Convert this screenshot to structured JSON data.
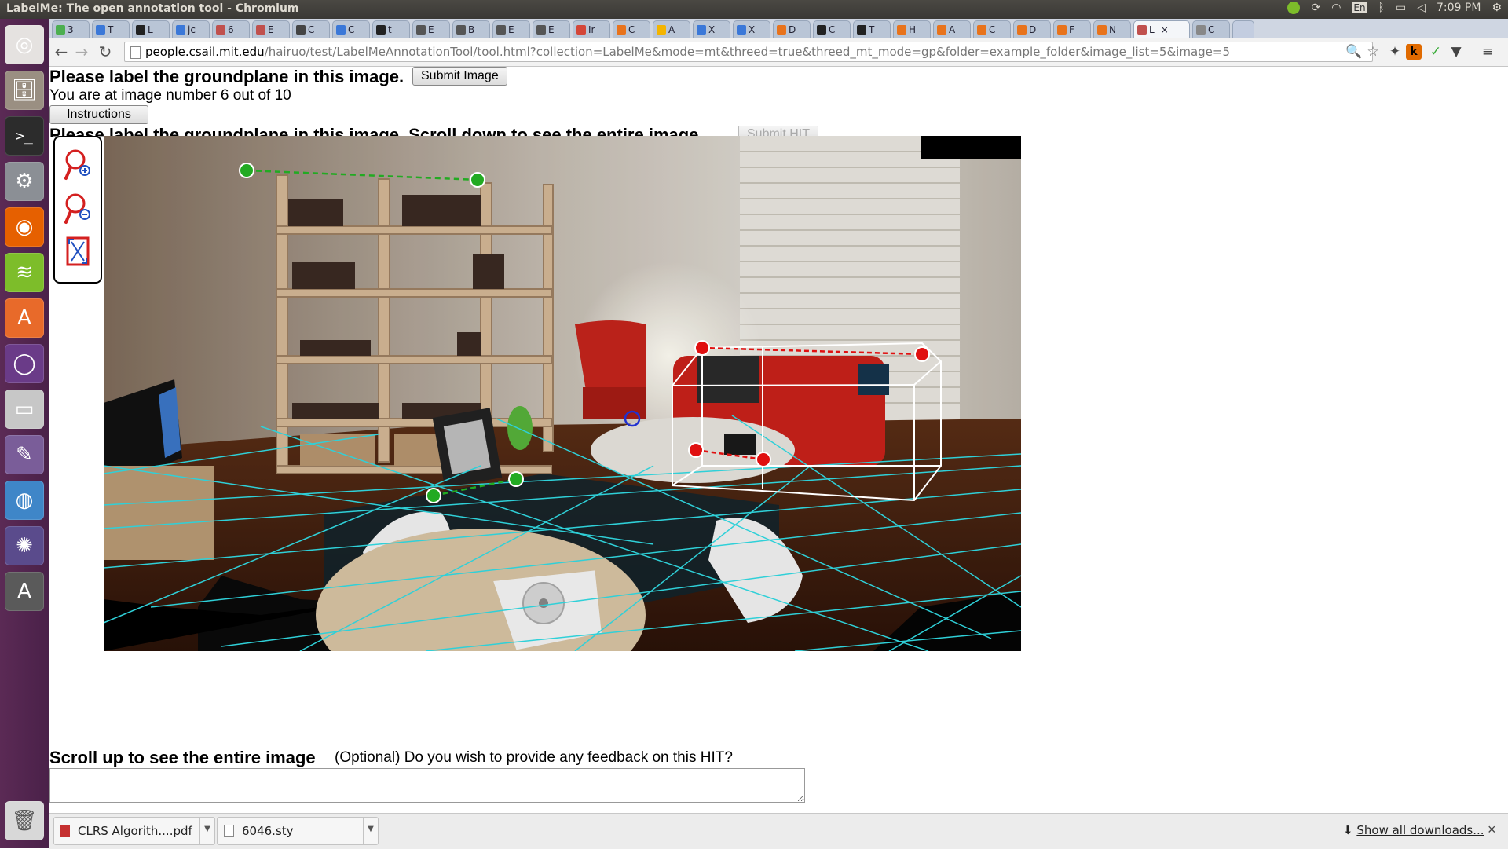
{
  "top_panel": {
    "window_title": "LabelMe: The open annotation tool - Chromium",
    "keyboard_layout": "En",
    "clock": "7:09 PM"
  },
  "launcher": {
    "items": [
      {
        "name": "ubuntu-dash-icon",
        "glyph": "◎",
        "color": "#e5e2e0"
      },
      {
        "name": "files-icon",
        "glyph": "🗄",
        "color": "#9a8f82"
      },
      {
        "name": "terminal-icon",
        "glyph": ">_",
        "color": "#2c2c2c"
      },
      {
        "name": "settings-icon",
        "glyph": "⚙",
        "color": "#8b8f95"
      },
      {
        "name": "firefox-icon",
        "glyph": "◉",
        "color": "#e66000"
      },
      {
        "name": "spotify-icon",
        "glyph": "≋",
        "color": "#7dbd2a"
      },
      {
        "name": "software-center-icon",
        "glyph": "A",
        "color": "#e86a2a"
      },
      {
        "name": "app-icon",
        "glyph": "◯",
        "color": "#6a3b88"
      },
      {
        "name": "disk-icon",
        "glyph": "▭",
        "color": "#c7c7c7"
      },
      {
        "name": "editor-icon",
        "glyph": "✎",
        "color": "#7a5d99"
      },
      {
        "name": "chromium-icon",
        "glyph": "◍",
        "color": "#3f86c8"
      },
      {
        "name": "app-spiral-icon",
        "glyph": "✺",
        "color": "#5a4b8c"
      },
      {
        "name": "updater-icon",
        "glyph": "A",
        "color": "#5a5a5a"
      }
    ],
    "trash": {
      "name": "trash-icon",
      "glyph": "🗑"
    }
  },
  "tabs": [
    {
      "label": "3",
      "color": "#4caf50"
    },
    {
      "label": "T",
      "color": "#3b78d8"
    },
    {
      "label": "L",
      "color": "#222222"
    },
    {
      "label": "jc",
      "color": "#3b78d8"
    },
    {
      "label": "6",
      "color": "#c0504d"
    },
    {
      "label": "E",
      "color": "#c0504d"
    },
    {
      "label": "C",
      "color": "#444444"
    },
    {
      "label": "C",
      "color": "#3b78d8"
    },
    {
      "label": "t",
      "color": "#222222"
    },
    {
      "label": "E",
      "color": "#555555"
    },
    {
      "label": "B",
      "color": "#555555"
    },
    {
      "label": "E",
      "color": "#555555"
    },
    {
      "label": "E",
      "color": "#555555"
    },
    {
      "label": "Ir",
      "color": "#d44638"
    },
    {
      "label": "C",
      "color": "#e8731c"
    },
    {
      "label": "A",
      "color": "#f4b400"
    },
    {
      "label": "X",
      "color": "#3b78d8"
    },
    {
      "label": "X",
      "color": "#3b78d8"
    },
    {
      "label": "D",
      "color": "#e8731c"
    },
    {
      "label": "C",
      "color": "#222222"
    },
    {
      "label": "T",
      "color": "#222222"
    },
    {
      "label": "H",
      "color": "#e8731c"
    },
    {
      "label": "A",
      "color": "#e8731c"
    },
    {
      "label": "C",
      "color": "#e8731c"
    },
    {
      "label": "D",
      "color": "#e8731c"
    },
    {
      "label": "F",
      "color": "#e8731c"
    },
    {
      "label": "N",
      "color": "#e8731c"
    },
    {
      "label": "L",
      "color": "#c0504d",
      "active": true
    },
    {
      "label": "C",
      "color": "#888888"
    }
  ],
  "toolbar": {
    "back": "←",
    "forward": "→",
    "reload": "↻",
    "url_host": "people.csail.mit.edu",
    "url_path": "/hairuo/test/LabelMeAnnotationTool/tool.html?collection=LabelMe&mode=mt&threed=true&threed_mt_mode=gp&folder=example_folder&image_list=5&image=5",
    "zoom": "🔍",
    "star": "☆",
    "menu": "≡"
  },
  "page": {
    "heading": "Please label the groundplane in this image.",
    "submit_image": "Submit Image",
    "progress": "You are at image number 6 out of 10",
    "instructions": "Instructions",
    "clipped_heading": "Please label the groundplane in this image. Scroll down to see the entire image",
    "submit_hit": "Submit HIT",
    "tools": {
      "zoom_in": "zoom-in-icon",
      "zoom_out": "zoom-out-icon",
      "fit": "fit-to-screen-icon"
    },
    "scroll_up": "Scroll up to see the entire image",
    "feedback_prompt": "(Optional) Do you wish to provide any feedback on this HIT?",
    "feedback_value": ""
  },
  "downloads": {
    "items": [
      {
        "label": "CLRS Algorith....pdf",
        "type": "pdf"
      },
      {
        "label": "6046.sty",
        "type": "file"
      }
    ],
    "show_all": "Show all downloads...",
    "close": "×"
  },
  "colors": {
    "grid_line": "#2fd0d8",
    "green_marker": "#22aa22",
    "red_marker": "#e01010",
    "box_outline": "#ffffff",
    "launcher_bg": "#5b2a55"
  }
}
